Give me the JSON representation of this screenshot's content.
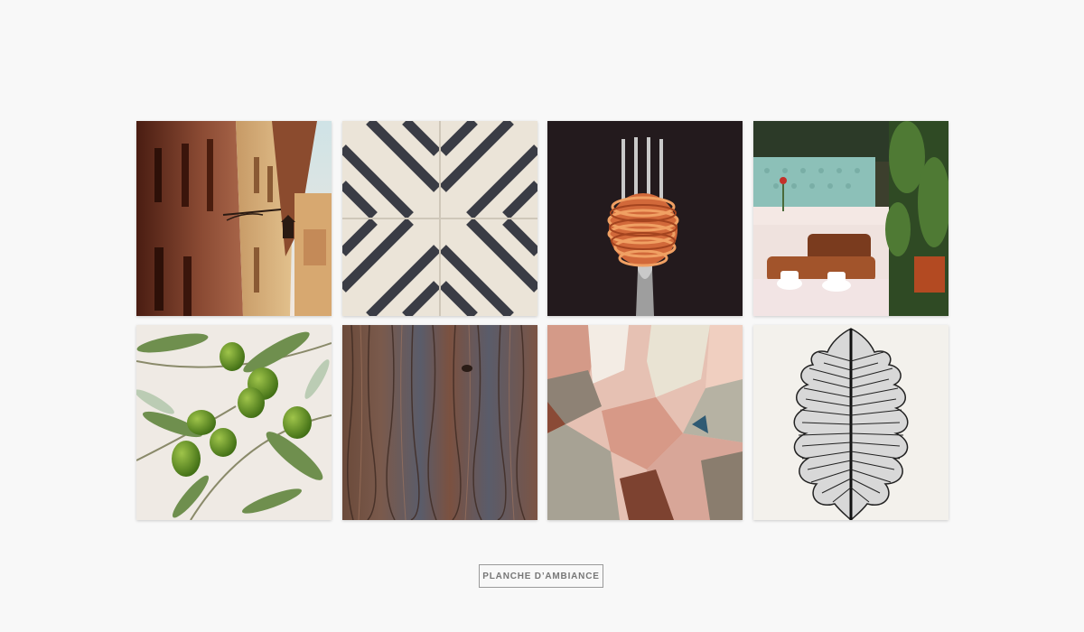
{
  "board": {
    "label": "PLANCHE D’AMBIANCE",
    "tiles": [
      {
        "subject": "old-town-street"
      },
      {
        "subject": "cement-tile-pattern"
      },
      {
        "subject": "spaghetti-on-fork"
      },
      {
        "subject": "restaurant-terrace"
      },
      {
        "subject": "olive-branch"
      },
      {
        "subject": "weathered-wood"
      },
      {
        "subject": "abstract-pink-shapes"
      },
      {
        "subject": "leaf-ink-drawing"
      }
    ]
  },
  "colors": {
    "background": "#f8f8f8",
    "label_border": "#9a9a9a",
    "label_text": "#777777"
  }
}
